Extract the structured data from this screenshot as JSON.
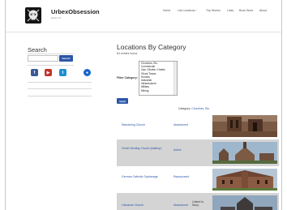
{
  "site": {
    "title": "UrbexObsession",
    "tagline": "Rusty Ox"
  },
  "nav": [
    "Home",
    "List Locations ›",
    "Trip Stories",
    "Links",
    "Book Store",
    "About"
  ],
  "sidebar": {
    "search_title": "Search",
    "search_placeholder": "",
    "search_button": "Search",
    "social": [
      {
        "icon": "facebook-icon",
        "glyph": "f",
        "color": "#3b5998"
      },
      {
        "icon": "youtube-icon",
        "glyph": "▶",
        "color": "#c4302b"
      },
      {
        "icon": "twitter-icon",
        "glyph": "t",
        "color": "#1d8fd2"
      },
      {
        "icon": "flickr-icon",
        "glyph": "●",
        "color": "#1668c7"
      }
    ]
  },
  "main": {
    "title": "Locations By Category",
    "count": "84 entries found.",
    "filter_label": "Filter Category:",
    "categories": [
      "Churches, Etc.",
      "Commercial",
      "Gas / Motels / Hotels",
      "Ghost Towns",
      "Houses",
      "Industrial",
      "Infrastructure",
      "Military",
      "Mining"
    ],
    "apply": "Apply",
    "category_prefix": "Category:",
    "selected_category": "Churches, Etc."
  },
  "rows": [
    {
      "name": "Wandering Church",
      "status": "Abandoned",
      "extra": ""
    },
    {
      "name": "Christ Herding Church (bulbmp)",
      "status": "Active",
      "extra": ""
    },
    {
      "name": "German Catholic Orphanage",
      "status": "Repurposed",
      "extra": ""
    },
    {
      "name": "Lifecause Church",
      "status": "Abandoned",
      "extra": "Linked to Story"
    }
  ]
}
